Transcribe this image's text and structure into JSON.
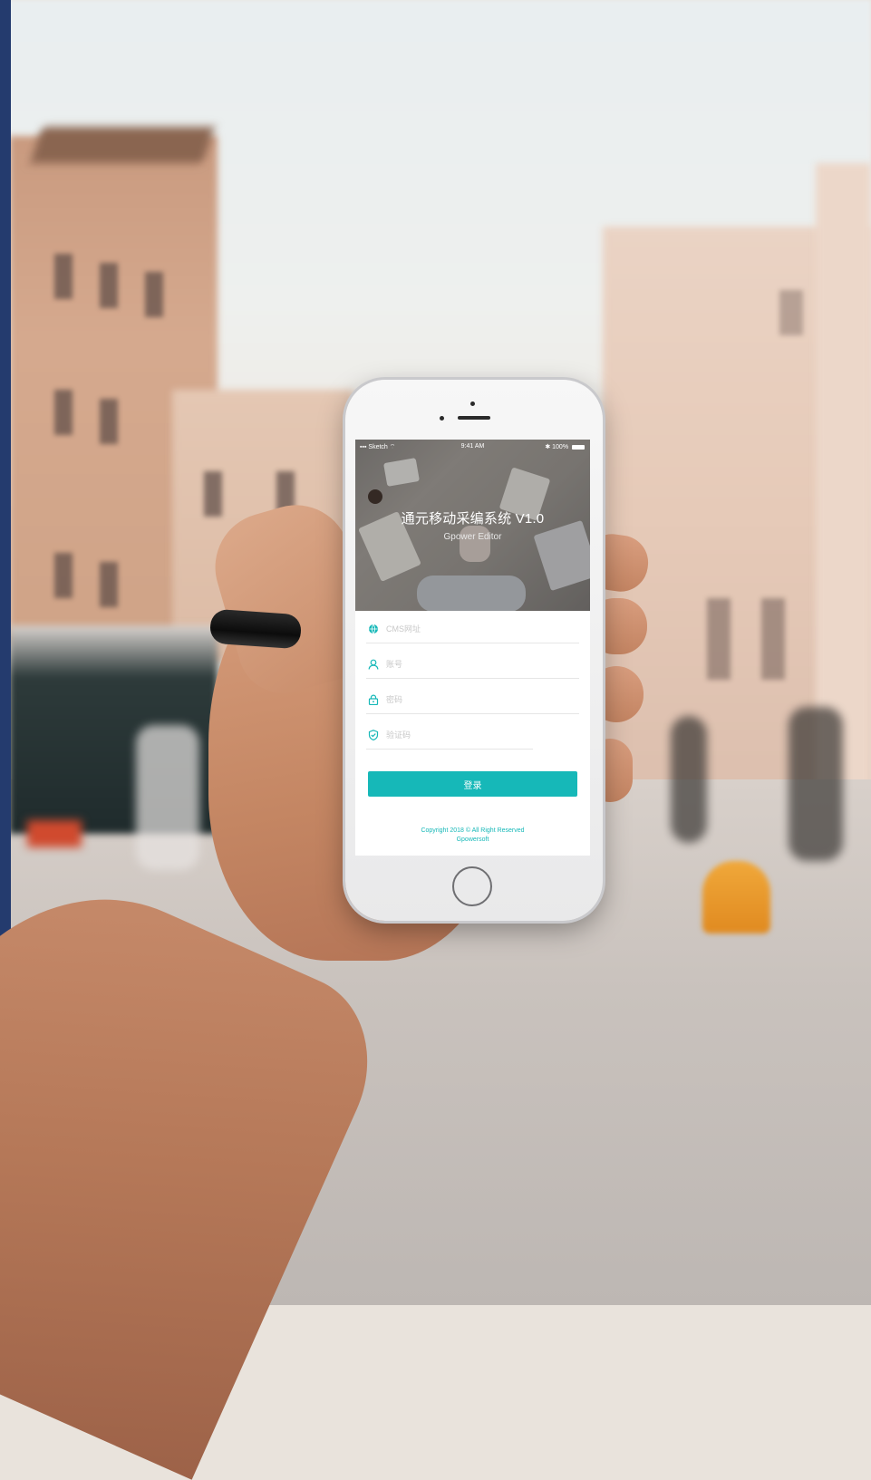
{
  "status_bar": {
    "carrier": "Sketch",
    "time": "9:41 AM",
    "battery": "100%"
  },
  "app": {
    "title": "通元移动采编系统 V1.0",
    "subtitle": "Gpower Editor"
  },
  "form": {
    "cms_placeholder": "CMS网址",
    "account_placeholder": "账号",
    "password_placeholder": "密码",
    "captcha_placeholder": "验证码",
    "login_label": "登录"
  },
  "footer": {
    "copyright_line1": "Copyright 2018 © All Right Reserved",
    "copyright_line2": "Gpowersoft"
  },
  "colors": {
    "accent": "#16b8b8",
    "side_bar": "#243b6e"
  },
  "icons": [
    "globe-icon",
    "user-icon",
    "lock-icon",
    "shield-check-icon",
    "wifi-icon",
    "signal-icon",
    "battery-icon"
  ]
}
